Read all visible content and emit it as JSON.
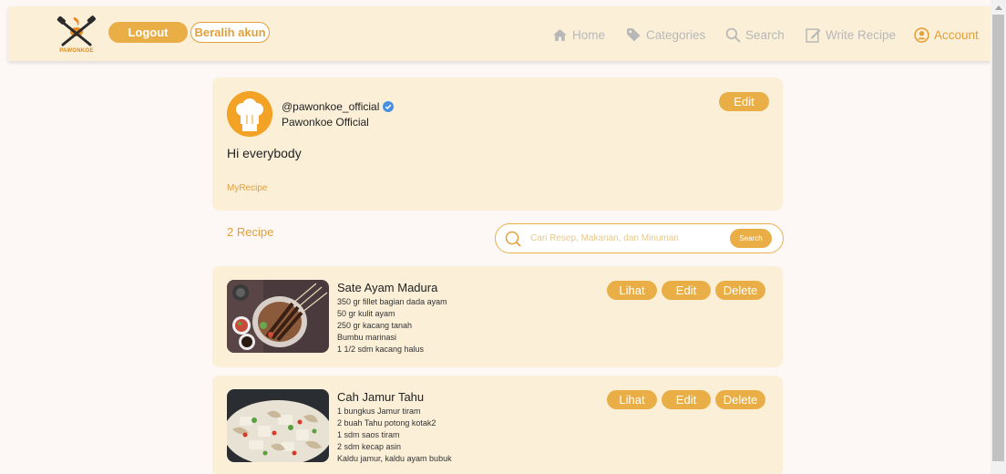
{
  "brand": {
    "logo_text": "PAWONKOE",
    "accent": "#e9ae46",
    "nav_bg": "#fbefd8"
  },
  "header": {
    "logout_label": "Logout",
    "switch_label": "Beralih akun",
    "nav": [
      {
        "label": "Home",
        "icon": "home-icon"
      },
      {
        "label": "Categories",
        "icon": "tag-icon"
      },
      {
        "label": "Search",
        "icon": "search-icon"
      },
      {
        "label": "Write Recipe",
        "icon": "edit-icon"
      },
      {
        "label": "Account",
        "icon": "user-circle-icon",
        "active": true
      }
    ]
  },
  "profile": {
    "username": "@pawonkoe_official",
    "display_name": "Pawonkoe Official",
    "bio": "Hi everybody",
    "my_recipe_label": "MyRecipe",
    "edit_label": "Edit"
  },
  "recipes_count": "2 Recipe",
  "search": {
    "placeholder": "Cari Resep, Makanan, dan Minuman",
    "button_label": "Search"
  },
  "recipes": [
    {
      "title": "Sate Ayam Madura",
      "ingredients": [
        "350 gr fillet bagian dada ayam",
        "50 gr kulit ayam",
        "250 gr kacang tanah",
        "Bumbu marinasi",
        "1 1/2 sdm kacang halus"
      ],
      "buttons": {
        "view": "Lihat",
        "edit": "Edit",
        "delete": "Delete"
      }
    },
    {
      "title": "Cah Jamur Tahu",
      "ingredients": [
        "1 bungkus Jamur tiram",
        "2 buah Tahu potong kotak2",
        "1 sdm saos tiram",
        "2 sdm kecap asin",
        "Kaldu jamur, kaldu ayam bubuk"
      ],
      "buttons": {
        "view": "Lihat",
        "edit": "Edit",
        "delete": "Delete"
      }
    }
  ]
}
